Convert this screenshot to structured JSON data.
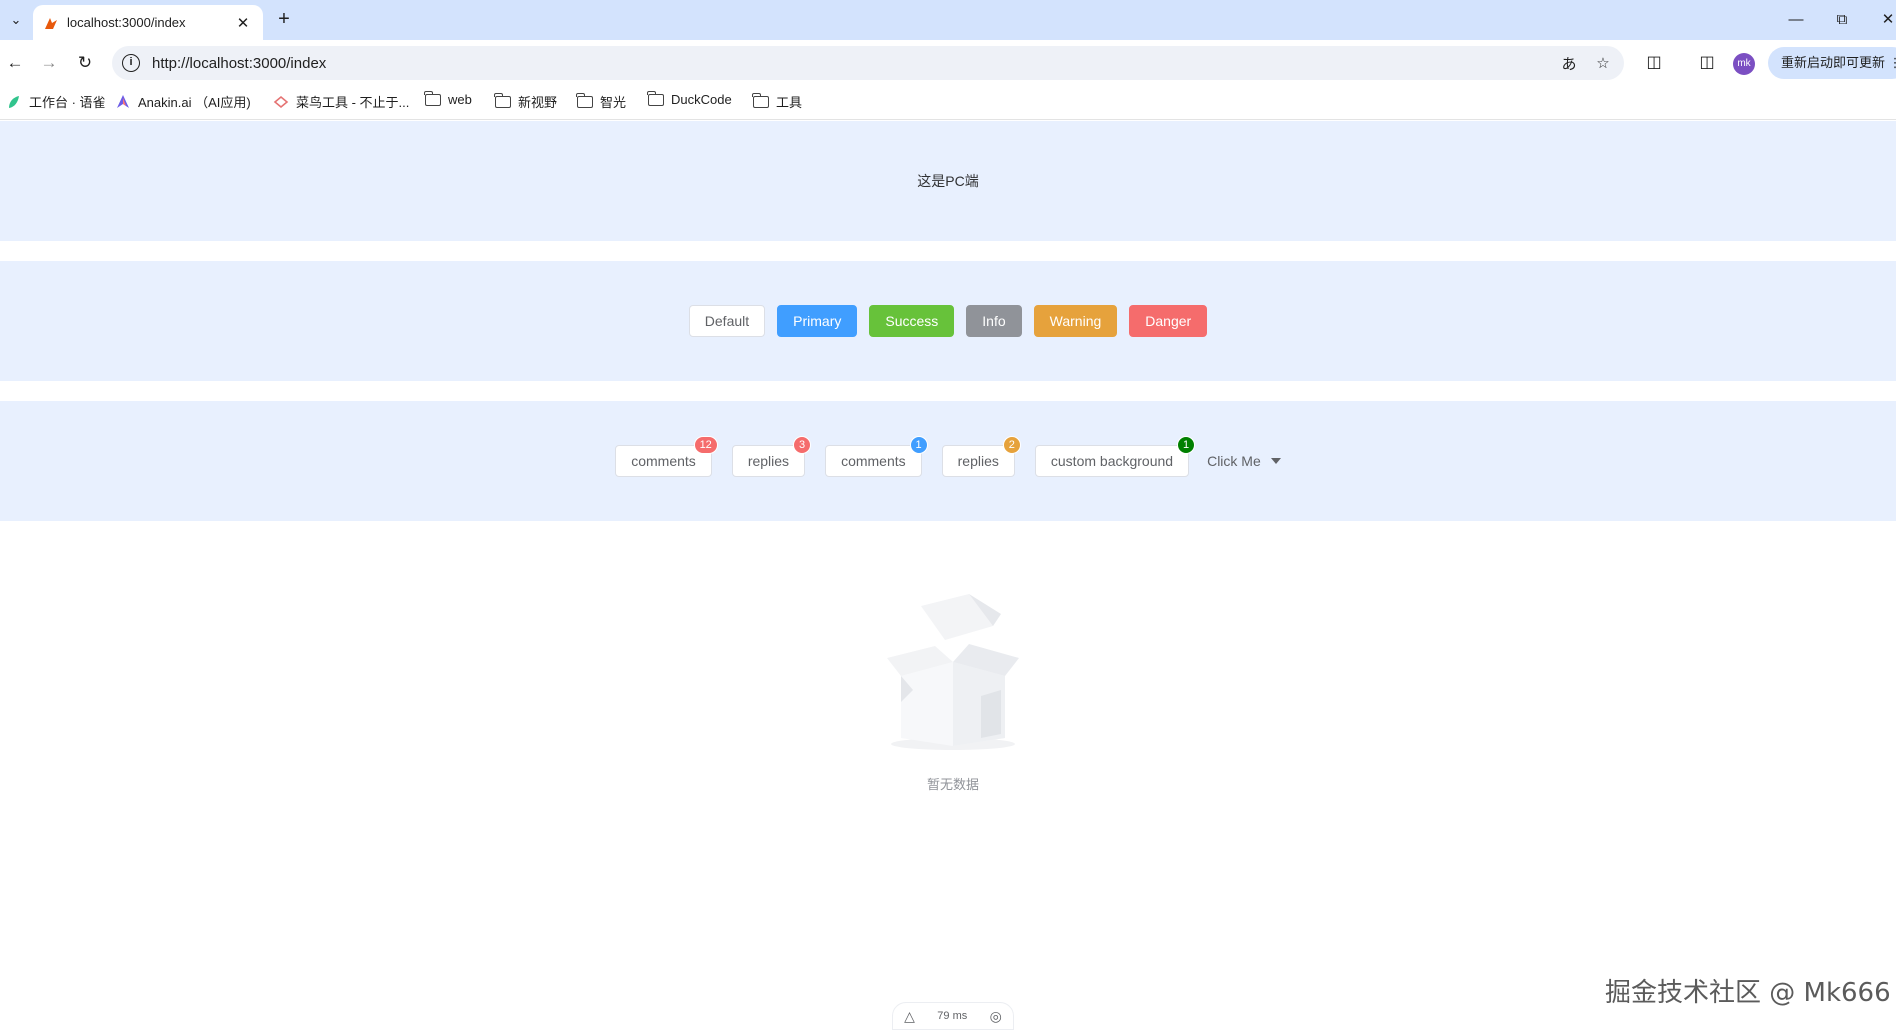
{
  "browser": {
    "tab_title": "localhost:3000/index",
    "url": "http://localhost:3000/index",
    "update_button": "重新启动即可更新",
    "profile_initials": "mk",
    "bookmarks": [
      {
        "label": "工作台 · 语雀",
        "icon": "yuque-icon"
      },
      {
        "label": "Anakin.ai （AI应用)",
        "icon": "anakin-icon"
      },
      {
        "label": "菜鸟工具 - 不止于...",
        "icon": "runoob-icon"
      },
      {
        "label": "web",
        "icon": "folder-icon"
      },
      {
        "label": "新视野",
        "icon": "folder-icon"
      },
      {
        "label": "智光",
        "icon": "folder-icon"
      },
      {
        "label": "DuckCode",
        "icon": "folder-icon"
      },
      {
        "label": "工具",
        "icon": "folder-icon"
      }
    ]
  },
  "page": {
    "pc_text": "这是PC端",
    "buttons": [
      "Default",
      "Primary",
      "Success",
      "Info",
      "Warning",
      "Danger"
    ],
    "badges": [
      {
        "label": "comments",
        "value": "12",
        "color": "#f56c6c"
      },
      {
        "label": "replies",
        "value": "3",
        "color": "#f56c6c"
      },
      {
        "label": "comments",
        "value": "1",
        "color": "#409eff"
      },
      {
        "label": "replies",
        "value": "2",
        "color": "#e6a23c"
      },
      {
        "label": "custom background",
        "value": "1",
        "color": "#008000"
      }
    ],
    "dropdown_label": "Click Me",
    "empty_text": "暂无数据"
  },
  "status_bar": {
    "timing": "79 ms"
  },
  "watermark": "掘金技术社区 @ Mk666",
  "colors": {
    "band": "#e8f0fe",
    "primary": "#409eff",
    "success": "#67c23a",
    "info": "#909399",
    "warning": "#e6a23c",
    "danger": "#f56c6c"
  }
}
